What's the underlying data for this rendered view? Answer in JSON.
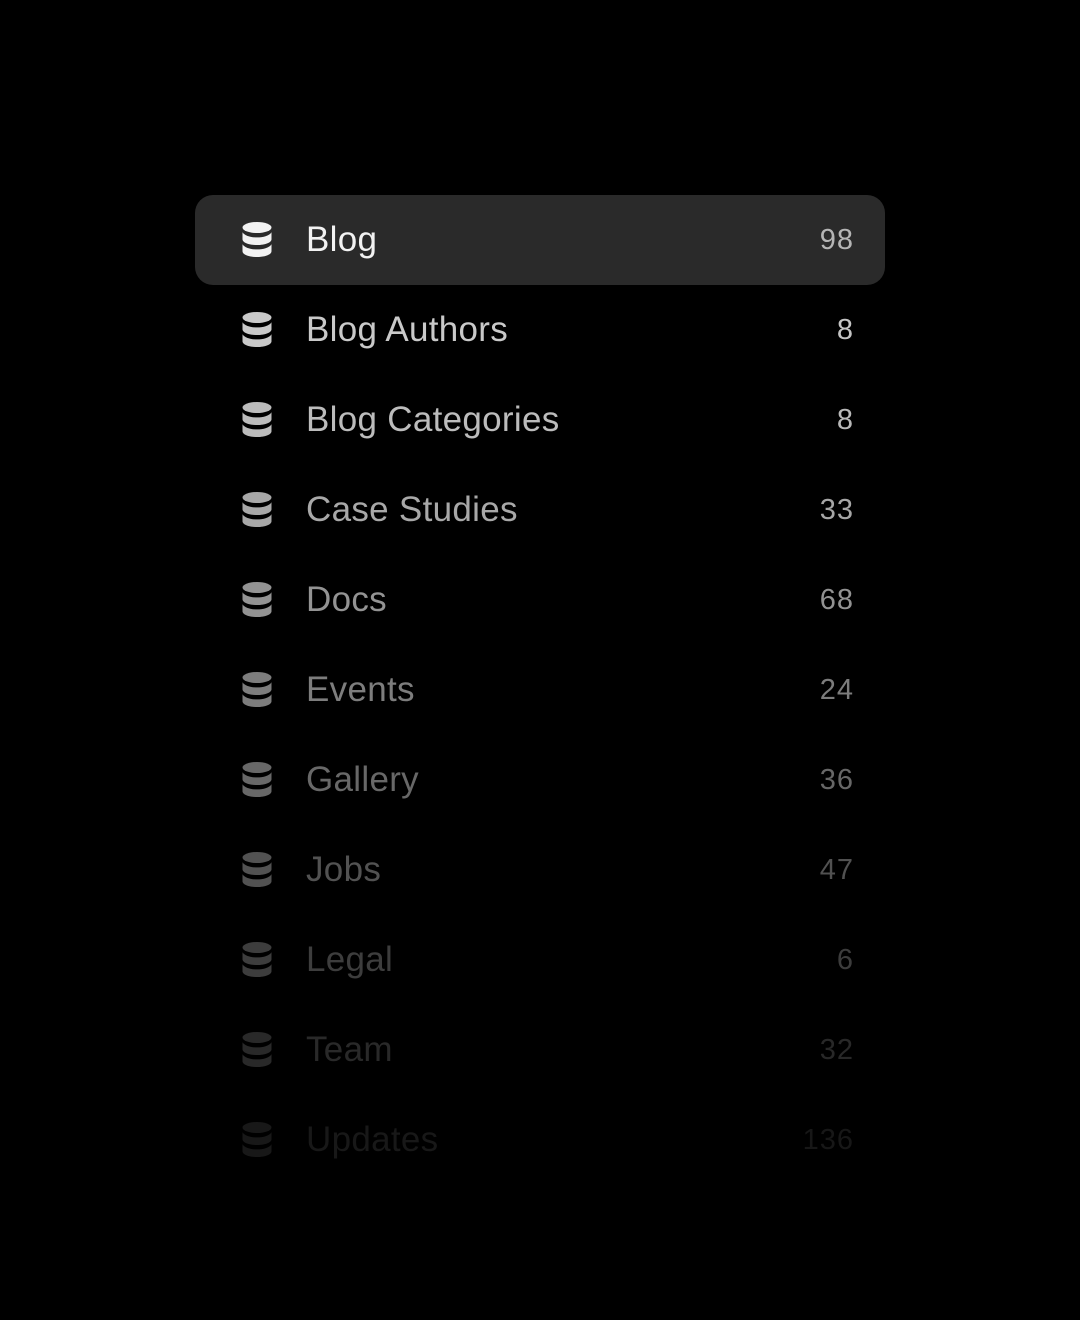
{
  "collections": {
    "items": [
      {
        "label": "Blog",
        "count": "98",
        "color": "#f2f2f2",
        "count_color": "#b5b5b5",
        "selected": true
      },
      {
        "label": "Blog Authors",
        "count": "8",
        "color": "#c9c9c9",
        "count_color": "#c4c4c4",
        "selected": false
      },
      {
        "label": "Blog Categories",
        "count": "8",
        "color": "#bcbcbc",
        "count_color": "#b8b8b8",
        "selected": false
      },
      {
        "label": "Case Studies",
        "count": "33",
        "color": "#a8a8a8",
        "count_color": "#a6a6a6",
        "selected": false
      },
      {
        "label": "Docs",
        "count": "68",
        "color": "#939393",
        "count_color": "#929292",
        "selected": false
      },
      {
        "label": "Events",
        "count": "24",
        "color": "#7d7d7d",
        "count_color": "#7c7c7c",
        "selected": false
      },
      {
        "label": "Gallery",
        "count": "36",
        "color": "#686868",
        "count_color": "#676767",
        "selected": false
      },
      {
        "label": "Jobs",
        "count": "47",
        "color": "#525252",
        "count_color": "#515151",
        "selected": false
      },
      {
        "label": "Legal",
        "count": "6",
        "color": "#3d3d3d",
        "count_color": "#3c3c3c",
        "selected": false
      },
      {
        "label": "Team",
        "count": "32",
        "color": "#292929",
        "count_color": "#282828",
        "selected": false
      },
      {
        "label": "Updates",
        "count": "136",
        "color": "#181818",
        "count_color": "#171717",
        "selected": false
      }
    ],
    "icon": "database-icon"
  }
}
